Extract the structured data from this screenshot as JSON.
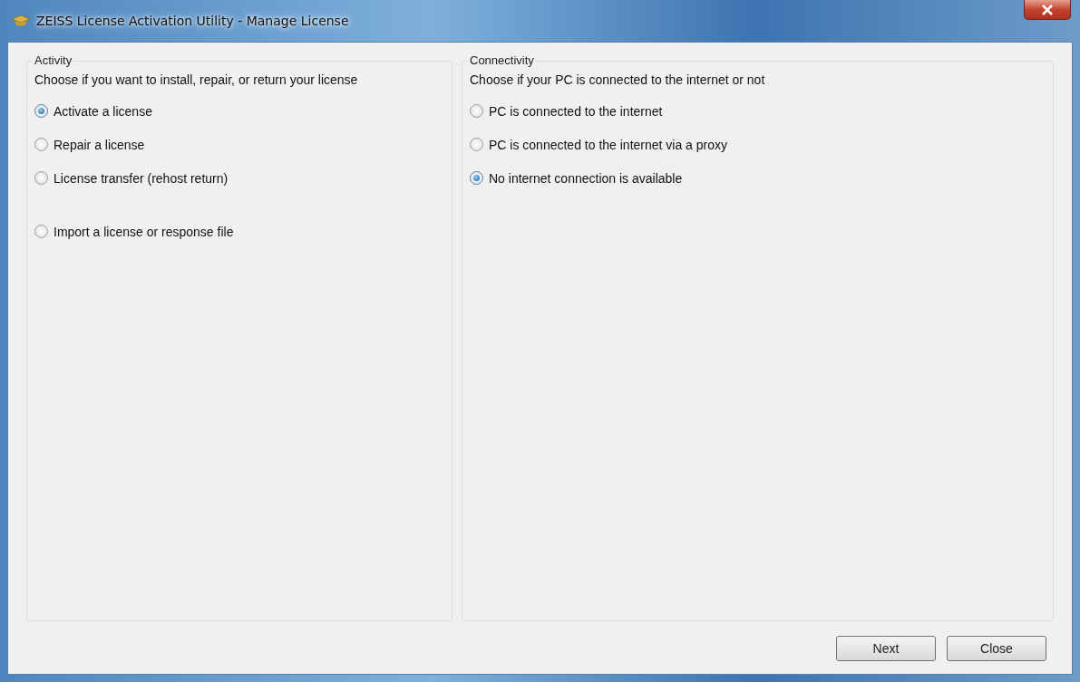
{
  "window": {
    "title": "ZEISS License Activation Utility - Manage License"
  },
  "groups": [
    {
      "title": "Activity",
      "description": "Choose if you want to install, repair, or return your license",
      "options": [
        {
          "label": "Activate a license",
          "selected": true
        },
        {
          "label": "Repair a license",
          "selected": false
        },
        {
          "label": "License transfer (rehost return)",
          "selected": false
        },
        {
          "label": "Import a license or response file",
          "selected": false
        }
      ]
    },
    {
      "title": "Connectivity",
      "description": "Choose if your PC is connected to the internet or not",
      "options": [
        {
          "label": "PC is connected to the internet",
          "selected": false
        },
        {
          "label": "PC is connected to the internet via a proxy",
          "selected": false
        },
        {
          "label": "No internet connection is available",
          "selected": true
        }
      ]
    }
  ],
  "buttons": [
    "Next",
    "Close"
  ]
}
